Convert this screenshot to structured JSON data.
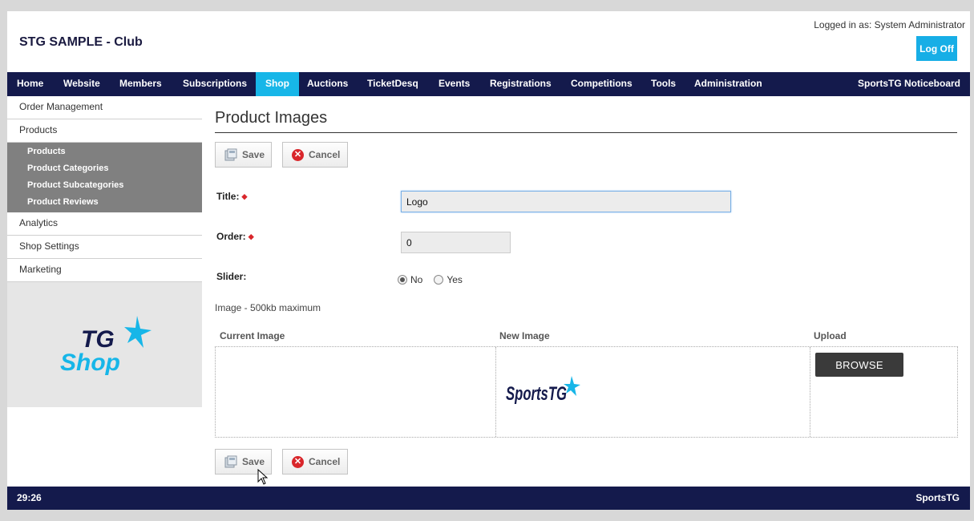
{
  "header": {
    "site_title": "STG SAMPLE - Club",
    "logged_in": "Logged in as: System Administrator",
    "logoff_label": "Log Off"
  },
  "nav": {
    "items": [
      "Home",
      "Website",
      "Members",
      "Subscriptions",
      "Shop",
      "Auctions",
      "TicketDesq",
      "Events",
      "Registrations",
      "Competitions",
      "Tools",
      "Administration"
    ],
    "active": "Shop",
    "right": "SportsTG Noticeboard"
  },
  "sidebar": {
    "items": [
      "Order Management",
      "Products"
    ],
    "sub_items": [
      "Products",
      "Product Categories",
      "Product Subcategories",
      "Product Reviews"
    ],
    "items_after": [
      "Analytics",
      "Shop Settings",
      "Marketing"
    ],
    "logo_text": [
      "TG",
      "Shop"
    ]
  },
  "page": {
    "title": "Product Images",
    "save_label": "Save",
    "cancel_label": "Cancel"
  },
  "form": {
    "title_label": "Title:",
    "title_value": "Logo",
    "order_label": "Order:",
    "order_value": "0",
    "slider_label": "Slider:",
    "slider_options": [
      "No",
      "Yes"
    ],
    "slider_selected": "No",
    "image_note": "Image - 500kb maximum"
  },
  "image_table": {
    "headers": [
      "Current Image",
      "New Image",
      "Upload"
    ],
    "new_image_logo_text": "SportsTG",
    "browse_label": "BROWSE"
  },
  "footer": {
    "timer": "29:26",
    "brand": "SportsTG"
  },
  "colors": {
    "nav_bg": "#141a4c",
    "accent": "#17b6e8",
    "required": "#d9262b"
  }
}
